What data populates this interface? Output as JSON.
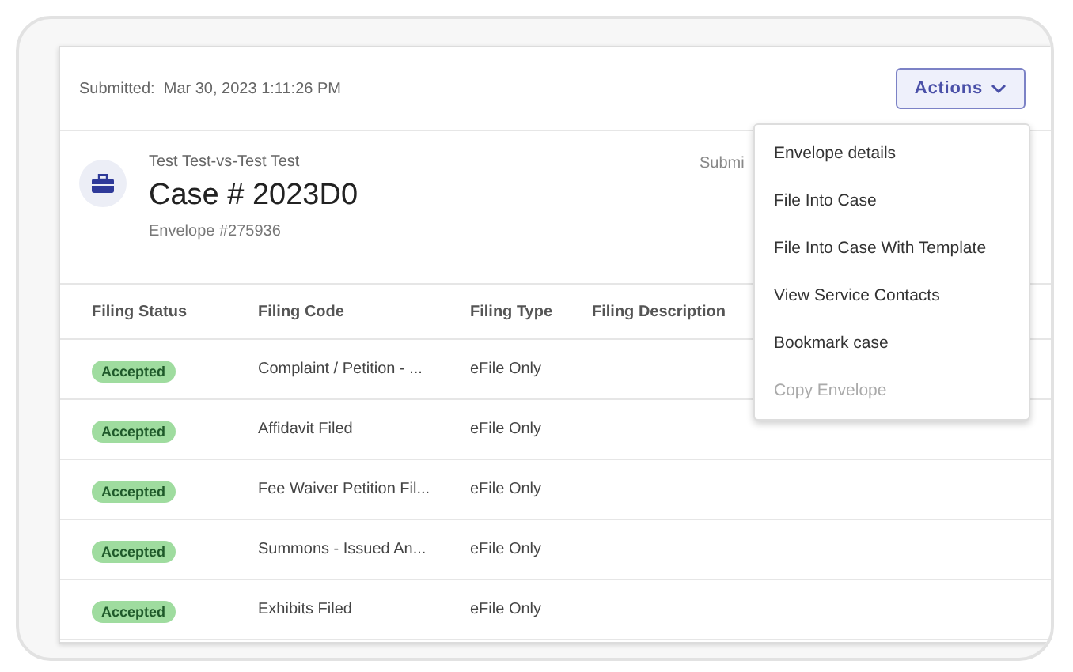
{
  "header": {
    "submitted_label": "Submitted:",
    "submitted_value": "Mar 30, 2023 1:11:26 PM",
    "actions_button": "Actions"
  },
  "case": {
    "parties": "Test Test-vs-Test Test",
    "title": "Case # 2023D0",
    "envelope": "Envelope #275936",
    "submitted_partial": "Submi"
  },
  "table": {
    "columns": [
      "Filing Status",
      "Filing Code",
      "Filing Type",
      "Filing Description"
    ],
    "rows": [
      {
        "status": "Accepted",
        "code": "Complaint / Petition - ...",
        "type": "eFile Only"
      },
      {
        "status": "Accepted",
        "code": "Affidavit Filed",
        "type": "eFile Only"
      },
      {
        "status": "Accepted",
        "code": "Fee Waiver Petition Fil...",
        "type": "eFile Only"
      },
      {
        "status": "Accepted",
        "code": "Summons - Issued An...",
        "type": "eFile Only"
      },
      {
        "status": "Accepted",
        "code": "Exhibits Filed",
        "type": "eFile Only"
      }
    ]
  },
  "actions_menu": [
    {
      "label": "Envelope details",
      "disabled": false
    },
    {
      "label": "File Into Case",
      "disabled": false
    },
    {
      "label": "File Into Case With Template",
      "disabled": false
    },
    {
      "label": "View Service Contacts",
      "disabled": false
    },
    {
      "label": "Bookmark case",
      "disabled": false
    },
    {
      "label": "Copy Envelope",
      "disabled": true
    }
  ]
}
